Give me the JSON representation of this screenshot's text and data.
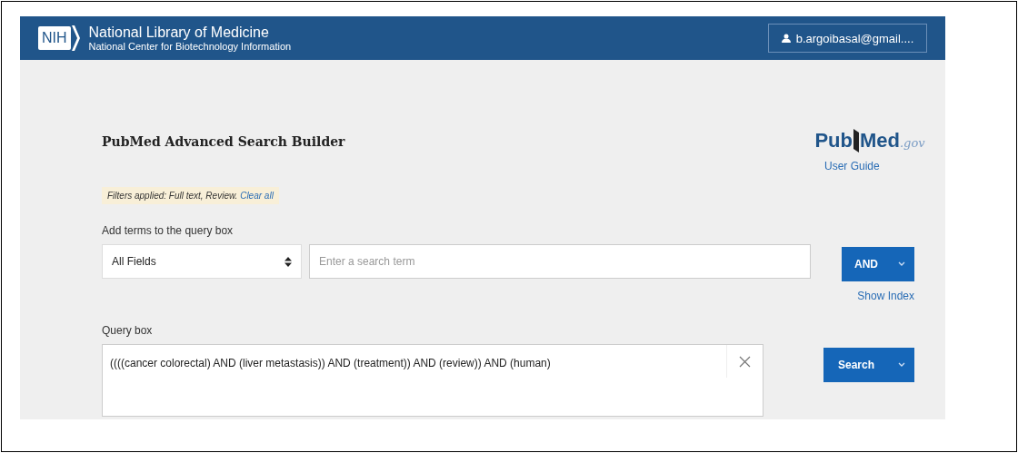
{
  "header": {
    "logo_text": "NIH",
    "title": "National Library of Medicine",
    "subtitle": "National Center for Biotechnology Information",
    "account": "b.argoibasal@gmail...."
  },
  "page_title": "PubMed Advanced Search Builder",
  "brand": {
    "part1": "Pub",
    "part2": "Med",
    "suffix": ".gov",
    "link": "User Guide"
  },
  "filters": {
    "text": "Filters applied: Full text, Review.",
    "link": "Clear all"
  },
  "add_terms": {
    "label": "Add terms to the query box",
    "field_select": "All Fields",
    "placeholder": "Enter a search term",
    "operator_button": "AND",
    "index_link": "Show Index"
  },
  "query": {
    "label": "Query box",
    "value": "((((cancer colorectal) AND (liver metastasis)) AND (treatment)) AND (review)) AND (human)",
    "search_button": "Search"
  }
}
